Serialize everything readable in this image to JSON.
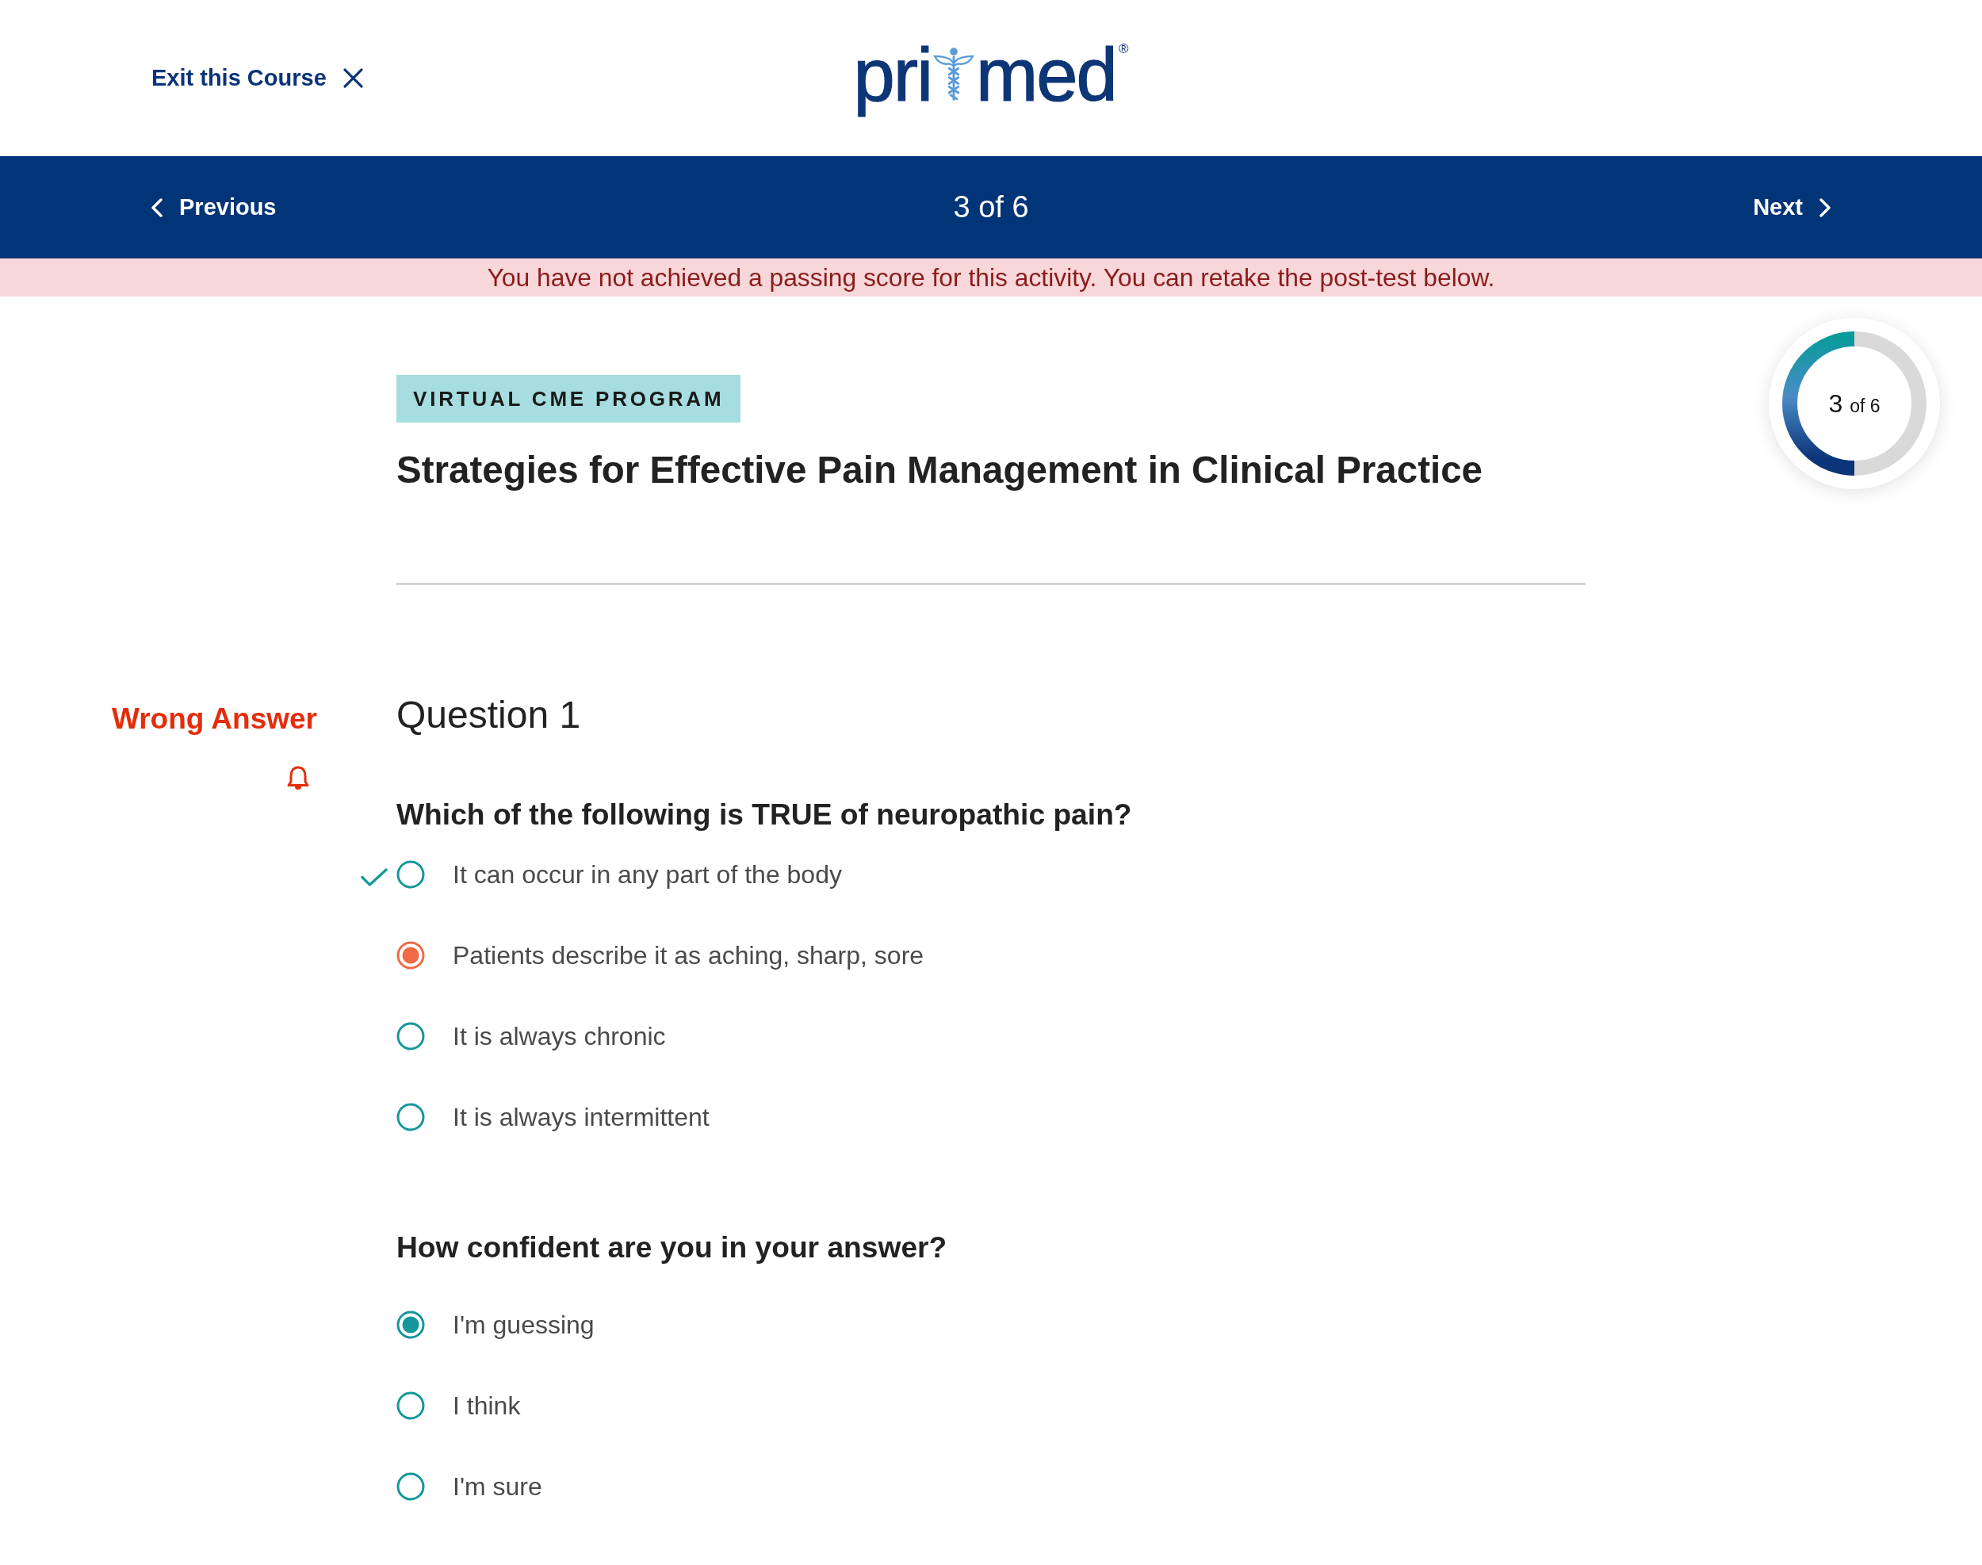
{
  "header": {
    "exit_link": "Exit this Course",
    "logo": {
      "left": "pri",
      "right": "med",
      "mark": "®"
    }
  },
  "nav": {
    "previous": "Previous",
    "counter": "3 of 6",
    "next": "Next"
  },
  "alert": "You have not achieved a passing score for this activity. You can retake the post-test below.",
  "progress": {
    "count": "3",
    "total": "of 6",
    "level": 0.5
  },
  "course": {
    "tag": "VIRTUAL CME PROGRAM",
    "title": "Strategies for Effective Pain Management in Clinical Practice"
  },
  "question": {
    "feedback": {
      "kind": "wrong",
      "label": "Wrong Answer"
    },
    "number": "Question 1",
    "prompt": "Which of the following is TRUE of neuropathic pain?",
    "options": [
      {
        "label": "It can occur in any part of the body",
        "correct": true,
        "selected": false
      },
      {
        "label": "Patients describe it as aching, sharp, sore",
        "correct": false,
        "selected": true
      },
      {
        "label": "It is always chronic",
        "correct": false,
        "selected": false
      },
      {
        "label": "It is always intermittent",
        "correct": false,
        "selected": false
      }
    ]
  },
  "confidence": {
    "prompt": "How confident are you in your answer?",
    "options": [
      {
        "label": "I'm guessing",
        "selected": true
      },
      {
        "label": "I think",
        "selected": false
      },
      {
        "label": "I'm sure",
        "selected": false
      }
    ]
  }
}
